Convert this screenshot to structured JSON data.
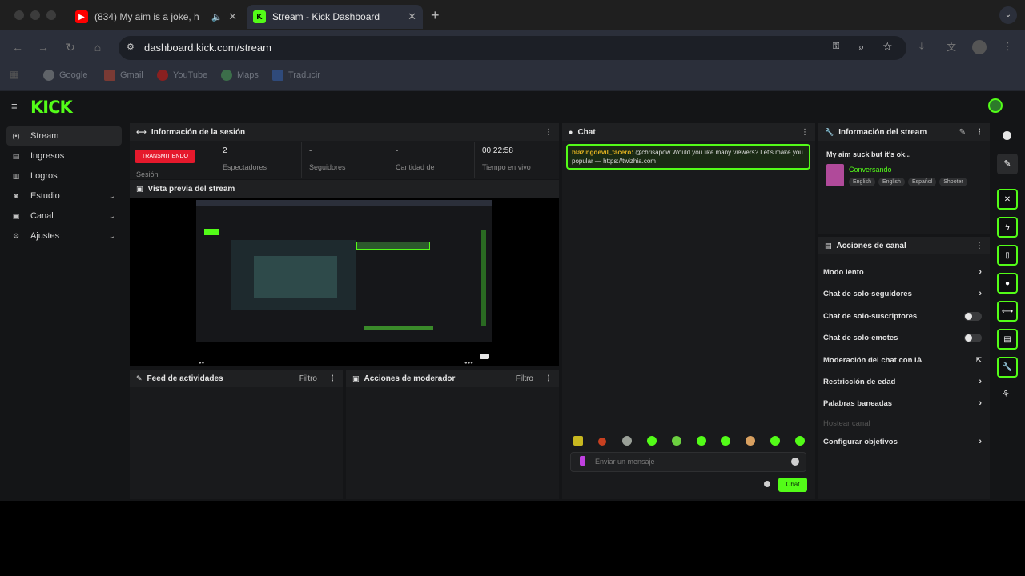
{
  "browser": {
    "tabs": [
      {
        "title": "(834) My aim is a joke, h",
        "active": false
      },
      {
        "title": "Stream - Kick Dashboard",
        "active": true
      }
    ],
    "url": "dashboard.kick.com/stream",
    "bookmarks": [
      "Google",
      "Gmail",
      "YouTube",
      "Maps",
      "Traducir"
    ]
  },
  "app": {
    "logo": "KICK",
    "sidebar": [
      {
        "label": "Stream",
        "icon": "stream-icon",
        "active": true
      },
      {
        "label": "Ingresos",
        "icon": "money-icon"
      },
      {
        "label": "Logros",
        "icon": "trophy-icon"
      },
      {
        "label": "Estudio",
        "icon": "studio-icon",
        "expand": true
      },
      {
        "label": "Canal",
        "icon": "channel-icon",
        "expand": true
      },
      {
        "label": "Ajustes",
        "icon": "gear-icon",
        "expand": true
      }
    ],
    "session": {
      "title": "Información de la sesión",
      "live_badge": "TRANSMITIENDO",
      "session_label": "Sesión",
      "stats": [
        {
          "value": "2",
          "label": "Espectadores"
        },
        {
          "value": "-",
          "label": "Seguidores"
        },
        {
          "value": "-",
          "label": "Cantidad de"
        },
        {
          "value": "00:22:58",
          "label": "Tiempo en vivo"
        }
      ]
    },
    "preview": {
      "title": "Vista previa del stream"
    },
    "activity": {
      "title": "Feed de actividades",
      "filter": "Filtro"
    },
    "mod_actions": {
      "title": "Acciones de moderador",
      "filter": "Filtro"
    },
    "chat": {
      "title": "Chat",
      "message": {
        "user": "blazingdevil_facero:",
        "text": "@chrisapow Would you like many viewers? Let's make you popular — https://twizhia.com"
      },
      "input_placeholder": "Enviar un mensaje",
      "send_label": "Chat"
    },
    "stream_info": {
      "title": "Información del stream",
      "stream_title": "My aim suck but it's ok...",
      "category": "Conversando",
      "tags": [
        "English",
        "English",
        "Español",
        "Shooter"
      ]
    },
    "channel_actions": {
      "title": "Acciones de canal",
      "items": [
        {
          "label": "Modo lento",
          "control": "arrow"
        },
        {
          "label": "Chat de solo-seguidores",
          "control": "arrow"
        },
        {
          "label": "Chat de solo-suscriptores",
          "control": "toggle"
        },
        {
          "label": "Chat de solo-emotes",
          "control": "toggle"
        },
        {
          "label": "Moderación del chat con IA",
          "control": "external"
        },
        {
          "label": "Restricción de edad",
          "control": "arrow"
        },
        {
          "label": "Palabras baneadas",
          "control": "arrow"
        },
        {
          "label": "Hostear canal",
          "control": "disabled"
        },
        {
          "label": "Configurar objetivos",
          "control": "arrow"
        }
      ]
    }
  },
  "colors": {
    "accent": "#53fc18",
    "live": "#e5192c",
    "youtube": "#ff0000",
    "kick": "#53fc18"
  }
}
